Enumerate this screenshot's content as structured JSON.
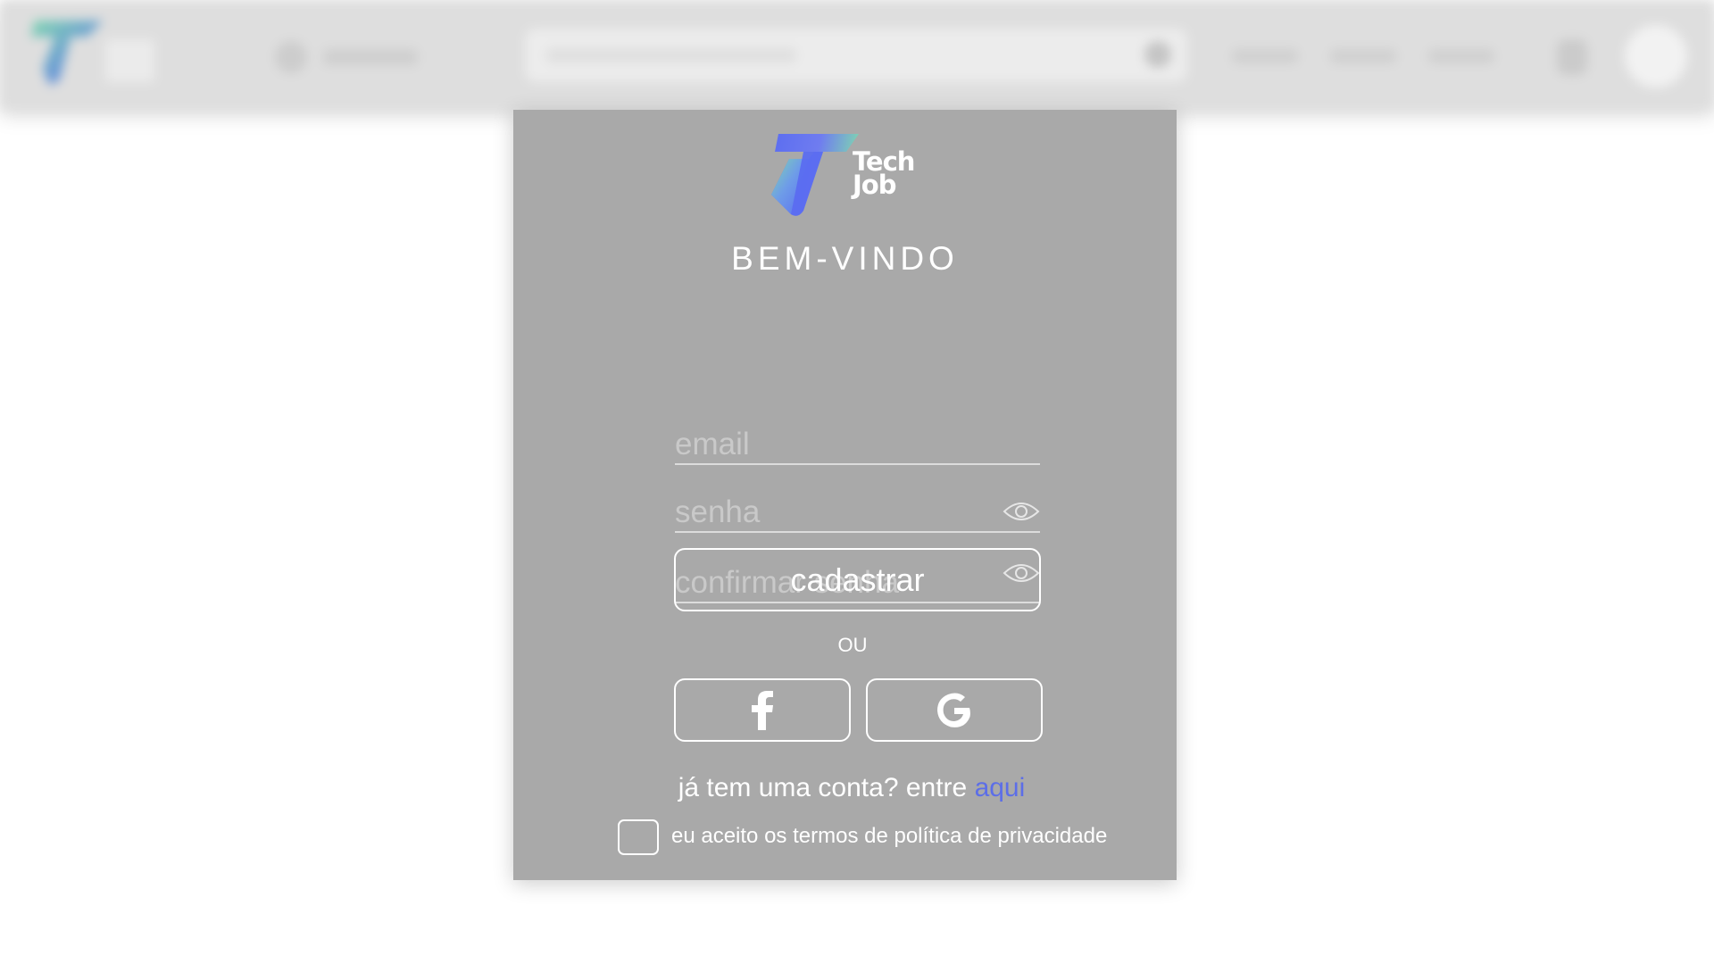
{
  "header": {
    "search_placeholder": ""
  },
  "card": {
    "logo_line1": "Tech",
    "logo_line2": "Job",
    "welcome": "BEM-VINDO",
    "email_placeholder": "email",
    "password_placeholder": "senha",
    "confirm_password_placeholder": "confirmar senha",
    "eye_icon": "eye-icon",
    "submit_label": "cadastrar",
    "or_label": "OU",
    "facebook_icon": "facebook-icon",
    "google_icon": "google-icon",
    "login_prompt": "já tem uma conta? entre ",
    "login_link": "aqui",
    "terms_label": "eu aceito os termos de política de privacidade"
  },
  "colors": {
    "card_bg": "#a9a9a9",
    "link": "#5c6ee8",
    "logo_blue": "#5b6df0",
    "logo_green": "#7fd6b0"
  }
}
